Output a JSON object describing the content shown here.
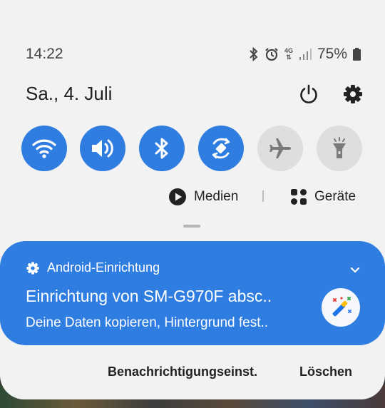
{
  "status_bar": {
    "time": "14:22",
    "network_type": "4G",
    "battery_percent": "75%",
    "icons": [
      "bluetooth-icon",
      "alarm-icon",
      "network-4g-icon",
      "signal-icon",
      "battery-icon"
    ]
  },
  "header": {
    "date": "Sa., 4. Juli",
    "icons": [
      "power-icon",
      "gear-icon"
    ]
  },
  "quick_toggles": [
    {
      "name": "wifi",
      "icon": "wifi-icon",
      "state": "on"
    },
    {
      "name": "sound",
      "icon": "volume-icon",
      "state": "on"
    },
    {
      "name": "bluetooth",
      "icon": "bluetooth-icon",
      "state": "on"
    },
    {
      "name": "auto-rotate",
      "icon": "auto-rotate-icon",
      "state": "on"
    },
    {
      "name": "airplane-mode",
      "icon": "airplane-icon",
      "state": "off"
    },
    {
      "name": "flashlight",
      "icon": "flashlight-icon",
      "state": "off"
    }
  ],
  "media_row": {
    "media_label": "Medien",
    "devices_label": "Geräte"
  },
  "notification": {
    "app_name": "Android-Einrichtung",
    "title": "Einrichtung von SM-G970F absc..",
    "text": "Deine Daten kopieren, Hintergrund fest..",
    "icon": "magic-wand-icon"
  },
  "actions": {
    "settings_label": "Benachrichtigungseinst.",
    "clear_label": "Löschen"
  },
  "colors": {
    "accent": "#2f7de1",
    "panel": "#f2f2f2",
    "toggle_off": "#dedede"
  }
}
